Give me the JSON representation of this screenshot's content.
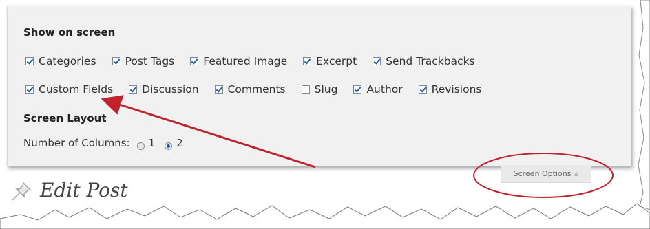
{
  "screen_options_panel": {
    "show_heading": "Show on screen",
    "checkbox_rows": [
      [
        {
          "label": "Categories",
          "checked": true
        },
        {
          "label": "Post Tags",
          "checked": true
        },
        {
          "label": "Featured Image",
          "checked": true
        },
        {
          "label": "Excerpt",
          "checked": true
        },
        {
          "label": "Send Trackbacks",
          "checked": true
        }
      ],
      [
        {
          "label": "Custom Fields",
          "checked": true
        },
        {
          "label": "Discussion",
          "checked": true
        },
        {
          "label": "Comments",
          "checked": true
        },
        {
          "label": "Slug",
          "checked": false
        },
        {
          "label": "Author",
          "checked": true
        },
        {
          "label": "Revisions",
          "checked": true
        }
      ]
    ],
    "layout_heading": "Screen Layout",
    "columns_label": "Number of Columns:",
    "column_options": [
      {
        "label": "1",
        "selected": false
      },
      {
        "label": "2",
        "selected": true
      }
    ]
  },
  "screen_options_tab": {
    "label": "Screen Options"
  },
  "page_title": "Edit Post",
  "colors": {
    "annotation_red": "#c0232b",
    "checkbox_check": "#1d57a6"
  }
}
